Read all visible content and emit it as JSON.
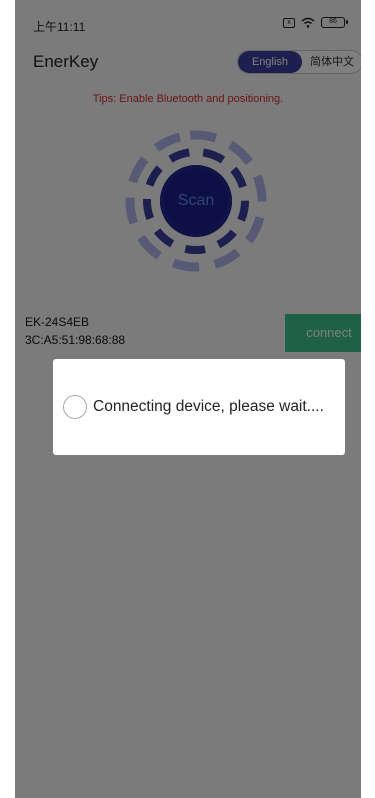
{
  "status_bar": {
    "time": "上午11:11",
    "sim_label": "x",
    "battery": "86"
  },
  "header": {
    "title": "EnerKey",
    "lang_english": "English",
    "lang_chinese": "简体中文"
  },
  "tips": "Tips: Enable Bluetooth and positioning.",
  "scan": {
    "label": "Scan"
  },
  "device": {
    "name": "EK-24S4EB",
    "mac": "3C:A5:51:98:68:88",
    "connect_label": "connect"
  },
  "dialog": {
    "message": "Connecting device, please wait...."
  },
  "colors": {
    "accent": "#3b3f9e",
    "scan_fill": "#1d1f8c",
    "connect": "#3cc28f",
    "tips": "#d42a2a"
  }
}
